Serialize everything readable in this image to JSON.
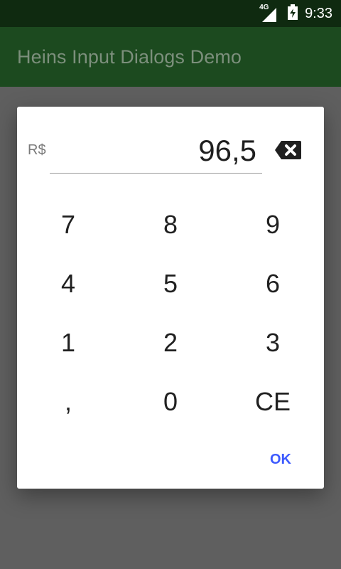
{
  "status_bar": {
    "network_type": "4G",
    "time": "9:33"
  },
  "app_bar": {
    "title": "Heins Input Dialogs Demo"
  },
  "dialog": {
    "currency_symbol": "R$",
    "amount": "96,5",
    "keys": [
      "7",
      "8",
      "9",
      "4",
      "5",
      "6",
      "1",
      "2",
      "3",
      ",",
      "0",
      "CE"
    ],
    "ok_label": "OK"
  },
  "colors": {
    "status_bar": "#0f2a10",
    "app_bar": "#1c4a1f",
    "accent": "#3d5afe"
  }
}
